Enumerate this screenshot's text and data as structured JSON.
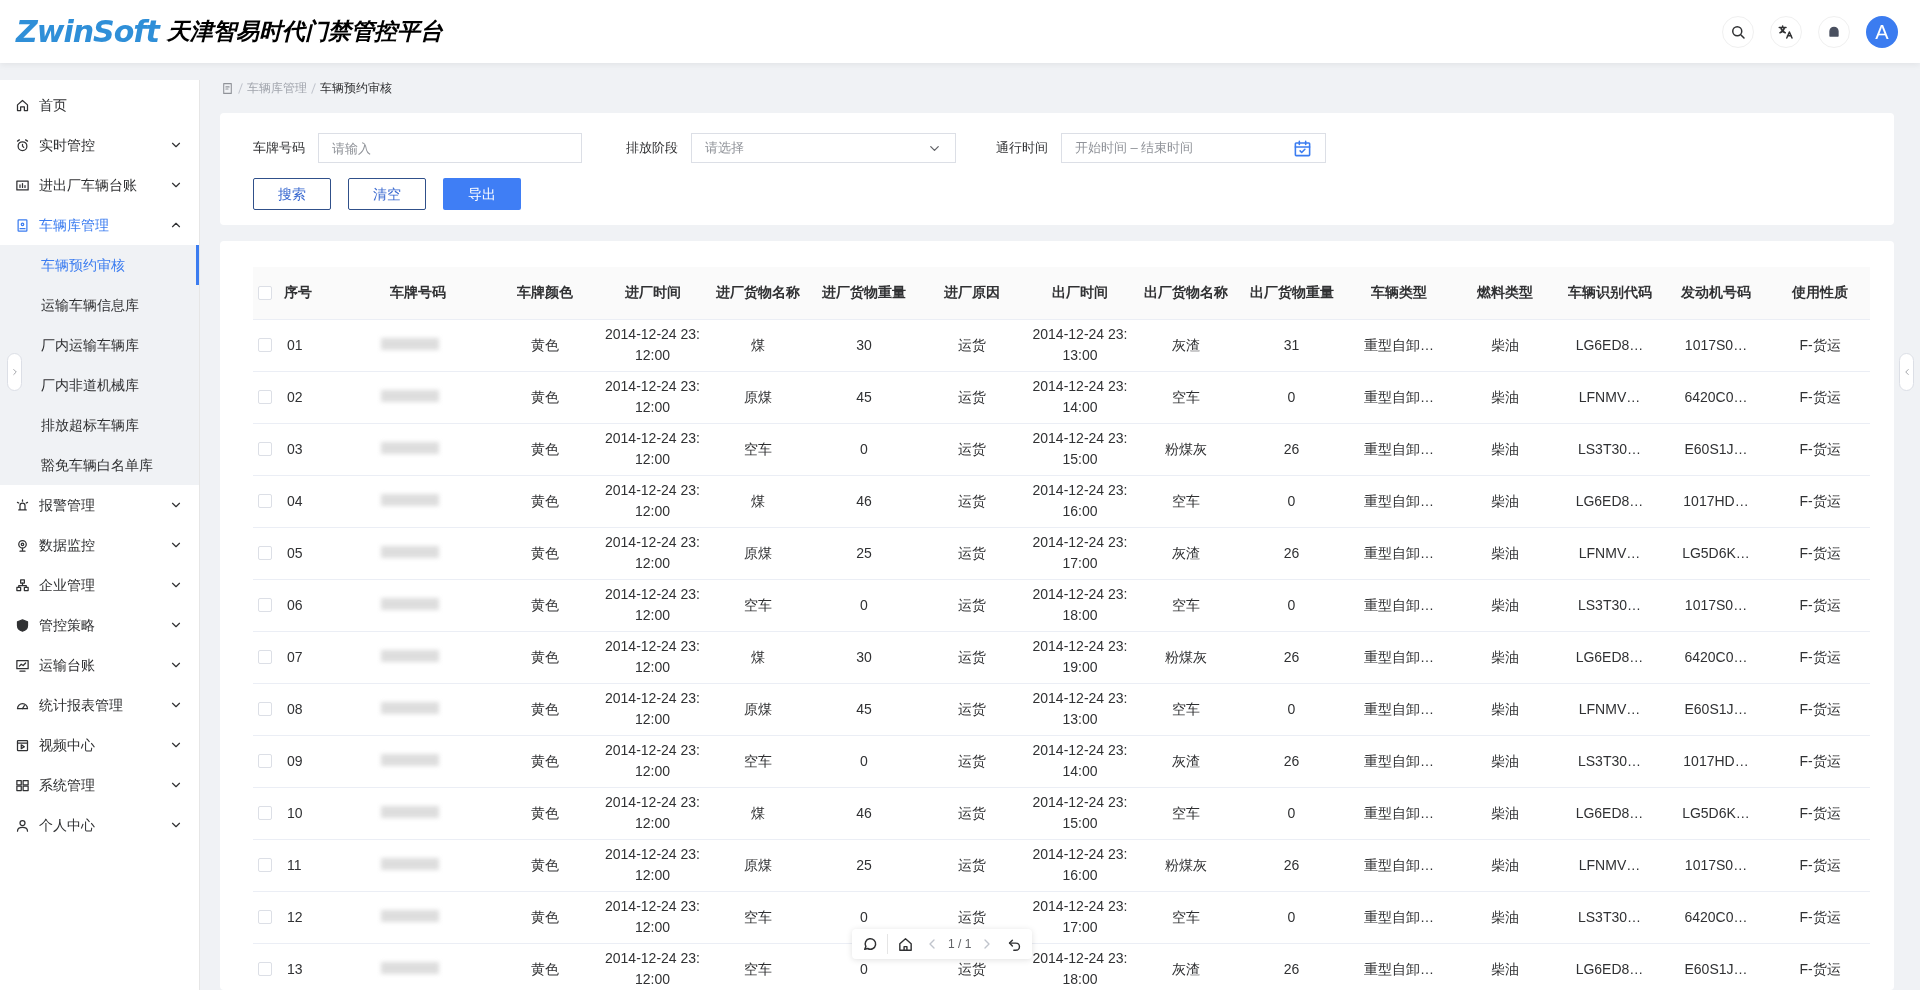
{
  "header": {
    "logo": "ZwinSoft",
    "title": "天津智易时代门禁管控平台",
    "avatar": "A"
  },
  "sidebar": {
    "items": [
      {
        "label": "首页",
        "kind": "link",
        "selected": false
      },
      {
        "label": "实时管控",
        "kind": "menu",
        "expanded": false,
        "selected": false
      },
      {
        "label": "进出厂车辆台账",
        "kind": "menu",
        "expanded": false,
        "selected": false
      },
      {
        "label": "车辆库管理",
        "kind": "menu",
        "expanded": true,
        "selected": true,
        "children": [
          {
            "label": "车辆预约审核",
            "selected": true
          },
          {
            "label": "运输车辆信息库",
            "selected": false
          },
          {
            "label": "厂内运输车辆库",
            "selected": false
          },
          {
            "label": "厂内非道机械库",
            "selected": false
          },
          {
            "label": "排放超标车辆库",
            "selected": false
          },
          {
            "label": "豁免车辆白名单库",
            "selected": false
          }
        ]
      },
      {
        "label": "报警管理",
        "kind": "menu",
        "expanded": false,
        "selected": false
      },
      {
        "label": "数据监控",
        "kind": "menu",
        "expanded": false,
        "selected": false
      },
      {
        "label": "企业管理",
        "kind": "menu",
        "expanded": false,
        "selected": false
      },
      {
        "label": "管控策略",
        "kind": "menu",
        "expanded": false,
        "selected": false
      },
      {
        "label": "运输台账",
        "kind": "menu",
        "expanded": false,
        "selected": false
      },
      {
        "label": "统计报表管理",
        "kind": "menu",
        "expanded": false,
        "selected": false
      },
      {
        "label": "视频中心",
        "kind": "menu",
        "expanded": false,
        "selected": false
      },
      {
        "label": "系统管理",
        "kind": "menu",
        "expanded": false,
        "selected": false
      },
      {
        "label": "个人中心",
        "kind": "menu",
        "expanded": false,
        "selected": false
      }
    ]
  },
  "breadcrumb": [
    "车辆库管理",
    "车辆预约审核"
  ],
  "filters": [
    {
      "label": "车牌号码",
      "kind": "input",
      "placeholder": "请输入"
    },
    {
      "label": "排放阶段",
      "kind": "select",
      "placeholder": "请选择"
    },
    {
      "label": "通行时间",
      "kind": "daterange",
      "placeholder": "开始时间 – 结束时间"
    }
  ],
  "buttons": [
    {
      "label": "搜索",
      "primary": false
    },
    {
      "label": "清空",
      "primary": false
    },
    {
      "label": "导出",
      "primary": true
    }
  ],
  "table": {
    "select_all": {
      "checked": false
    },
    "columns": [
      "序号",
      "车牌号码",
      "车牌颜色",
      "进厂时间",
      "进厂货物名称",
      "进厂货物重量",
      "进厂原因",
      "出厂时间",
      "出厂货物名称",
      "出厂货物重量",
      "车辆类型",
      "燃料类型",
      "车辆识别代码",
      "发动机号码",
      "使用性质"
    ],
    "rows": [
      {
        "checked": false,
        "cells": [
          "01",
          "",
          "黄色",
          "2014-12-24 23:12:00",
          "煤",
          "30",
          "运货",
          "2014-12-24 23:13:00",
          "灰渣",
          "31",
          "重型自卸…",
          "柴油",
          "LG6ED8…",
          "1017S0…",
          "F-货运"
        ]
      },
      {
        "checked": false,
        "cells": [
          "02",
          "",
          "黄色",
          "2014-12-24 23:12:00",
          "原煤",
          "45",
          "运货",
          "2014-12-24 23:14:00",
          "空车",
          "0",
          "重型自卸…",
          "柴油",
          "LFNMV…",
          "6420C0…",
          "F-货运"
        ]
      },
      {
        "checked": false,
        "cells": [
          "03",
          "",
          "黄色",
          "2014-12-24 23:12:00",
          "空车",
          "0",
          "运货",
          "2014-12-24 23:15:00",
          "粉煤灰",
          "26",
          "重型自卸…",
          "柴油",
          "LS3T30…",
          "E60S1J…",
          "F-货运"
        ]
      },
      {
        "checked": false,
        "cells": [
          "04",
          "",
          "黄色",
          "2014-12-24 23:12:00",
          "煤",
          "46",
          "运货",
          "2014-12-24 23:16:00",
          "空车",
          "0",
          "重型自卸…",
          "柴油",
          "LG6ED8…",
          "1017HD…",
          "F-货运"
        ]
      },
      {
        "checked": false,
        "cells": [
          "05",
          "",
          "黄色",
          "2014-12-24 23:12:00",
          "原煤",
          "25",
          "运货",
          "2014-12-24 23:17:00",
          "灰渣",
          "26",
          "重型自卸…",
          "柴油",
          "LFNMV…",
          "LG5D6K…",
          "F-货运"
        ]
      },
      {
        "checked": false,
        "cells": [
          "06",
          "",
          "黄色",
          "2014-12-24 23:12:00",
          "空车",
          "0",
          "运货",
          "2014-12-24 23:18:00",
          "空车",
          "0",
          "重型自卸…",
          "柴油",
          "LS3T30…",
          "1017S0…",
          "F-货运"
        ]
      },
      {
        "checked": false,
        "cells": [
          "07",
          "",
          "黄色",
          "2014-12-24 23:12:00",
          "煤",
          "30",
          "运货",
          "2014-12-24 23:19:00",
          "粉煤灰",
          "26",
          "重型自卸…",
          "柴油",
          "LG6ED8…",
          "6420C0…",
          "F-货运"
        ]
      },
      {
        "checked": false,
        "cells": [
          "08",
          "",
          "黄色",
          "2014-12-24 23:12:00",
          "原煤",
          "45",
          "运货",
          "2014-12-24 23:13:00",
          "空车",
          "0",
          "重型自卸…",
          "柴油",
          "LFNMV…",
          "E60S1J…",
          "F-货运"
        ]
      },
      {
        "checked": false,
        "cells": [
          "09",
          "",
          "黄色",
          "2014-12-24 23:12:00",
          "空车",
          "0",
          "运货",
          "2014-12-24 23:14:00",
          "灰渣",
          "26",
          "重型自卸…",
          "柴油",
          "LS3T30…",
          "1017HD…",
          "F-货运"
        ]
      },
      {
        "checked": false,
        "cells": [
          "10",
          "",
          "黄色",
          "2014-12-24 23:12:00",
          "煤",
          "46",
          "运货",
          "2014-12-24 23:15:00",
          "空车",
          "0",
          "重型自卸…",
          "柴油",
          "LG6ED8…",
          "LG5D6K…",
          "F-货运"
        ]
      },
      {
        "checked": false,
        "cells": [
          "11",
          "",
          "黄色",
          "2014-12-24 23:12:00",
          "原煤",
          "25",
          "运货",
          "2014-12-24 23:16:00",
          "粉煤灰",
          "26",
          "重型自卸…",
          "柴油",
          "LFNMV…",
          "1017S0…",
          "F-货运"
        ]
      },
      {
        "checked": false,
        "cells": [
          "12",
          "",
          "黄色",
          "2014-12-24 23:12:00",
          "空车",
          "0",
          "运货",
          "2014-12-24 23:17:00",
          "空车",
          "0",
          "重型自卸…",
          "柴油",
          "LS3T30…",
          "6420C0…",
          "F-货运"
        ]
      },
      {
        "checked": false,
        "cells": [
          "13",
          "",
          "黄色",
          "2014-12-24 23:12:00",
          "空车",
          "0",
          "运货",
          "2014-12-24 23:18:00",
          "灰渣",
          "26",
          "重型自卸…",
          "柴油",
          "LG6ED8…",
          "E60S1J…",
          "F-货运"
        ]
      }
    ]
  },
  "pager": {
    "text": "1 / 1"
  }
}
